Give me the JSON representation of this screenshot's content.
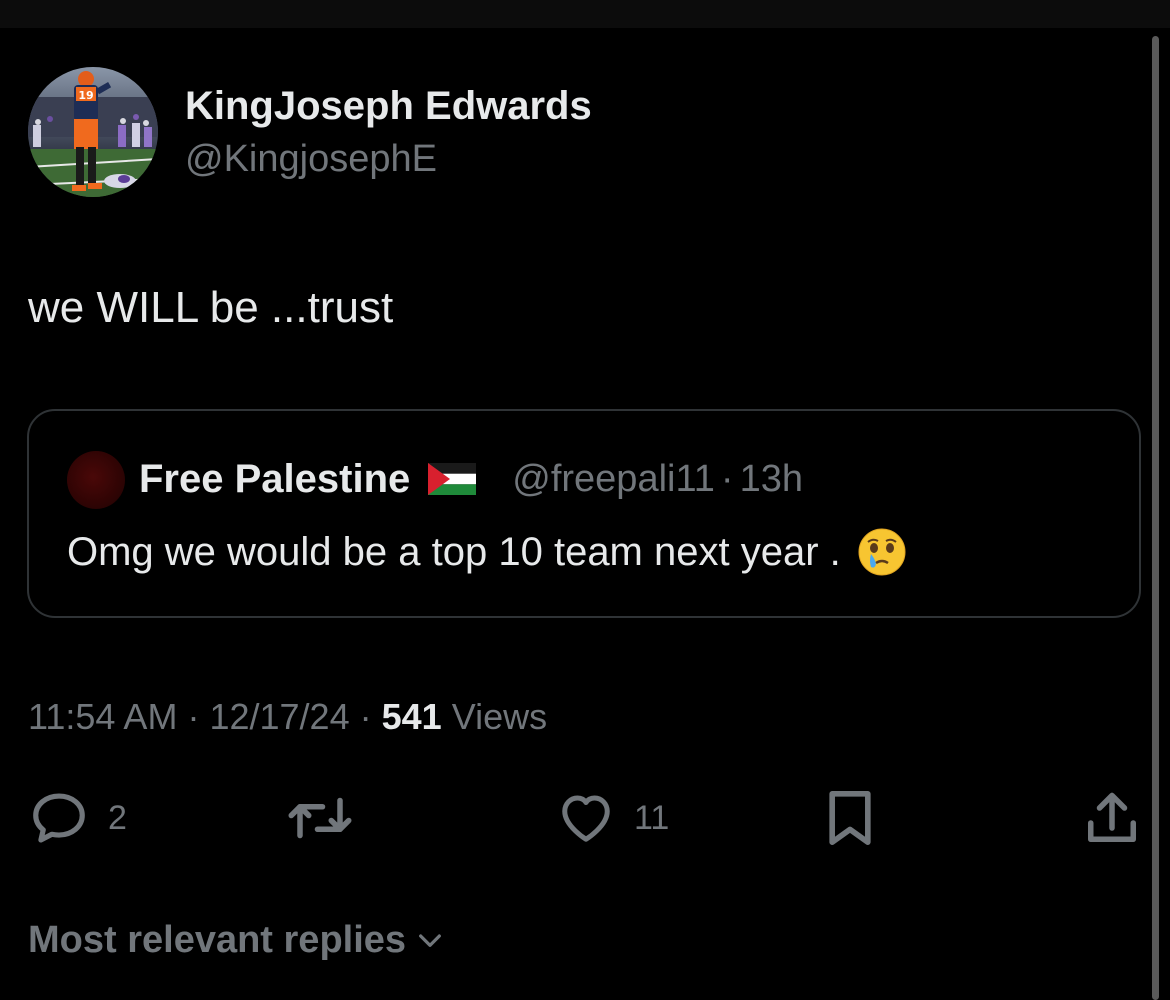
{
  "author": {
    "name": "KingJoseph Edwards",
    "handle": "@KingjosephE",
    "avatar_icon": "football-player-avatar",
    "jersey_number": "19"
  },
  "tweet": {
    "text": "we WILL be ...trust"
  },
  "quoted_tweet": {
    "name": "Free Palestine",
    "flag_icon": "palestine-flag",
    "handle": "@freepali11",
    "separator": "·",
    "time": "13h",
    "text": "Omg we would be a top 10 team next year .",
    "emoji_icon": "face-holding-back-tears-emoji"
  },
  "meta": {
    "time": "11:54 AM",
    "sep1": "·",
    "date": "12/17/24",
    "sep2": "·",
    "views_count": "541",
    "views_label": "Views"
  },
  "actions": {
    "reply": {
      "icon": "reply-icon",
      "count": "2"
    },
    "repost": {
      "icon": "repost-icon",
      "count": ""
    },
    "like": {
      "icon": "heart-icon",
      "count": "11"
    },
    "bookmark": {
      "icon": "bookmark-icon"
    },
    "share": {
      "icon": "share-icon"
    }
  },
  "replies_filter": {
    "label": "Most relevant replies",
    "icon": "chevron-down-icon"
  },
  "colors": {
    "background": "#000000",
    "primary_text": "#e7e9ea",
    "secondary_text": "#71767b",
    "border": "#2f3336"
  }
}
